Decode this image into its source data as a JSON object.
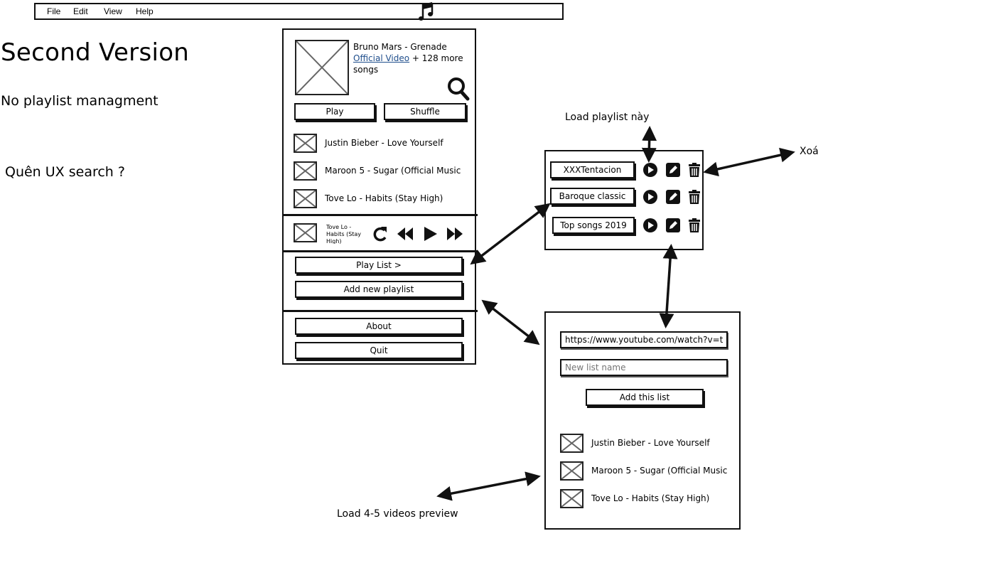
{
  "menubar": {
    "items": [
      "File",
      "Edit",
      "View",
      "Help"
    ],
    "app_icon": "music-note-icon"
  },
  "notes": {
    "title": "Second Version",
    "note1": "No playlist managment",
    "note2": "Quên UX search ?"
  },
  "player": {
    "now_playing": {
      "title": "Bruno Mars - Grenade",
      "link_text": "Official Video",
      "more_text": " + 128 more songs"
    },
    "buttons": {
      "play": "Play",
      "shuffle": "Shuffle"
    },
    "queue": [
      "Justin Bieber - Love Yourself",
      "Maroon 5 - Sugar (Official Music",
      "Tove Lo - Habits (Stay High)"
    ],
    "mini_player": {
      "title": "Tove Lo - Habits (Stay High)",
      "controls": [
        "repeat-icon",
        "rewind-icon",
        "play-icon",
        "fast-forward-icon"
      ]
    },
    "menu": {
      "playlist": "Play List >",
      "add_playlist": "Add new playlist",
      "about": "About",
      "quit": "Quit"
    }
  },
  "playlists": {
    "items": [
      {
        "name": "XXXTentacion"
      },
      {
        "name": "Baroque classic"
      },
      {
        "name": "Top songs 2019"
      }
    ],
    "actions": [
      "play-icon",
      "edit-icon",
      "trash-icon"
    ]
  },
  "add_list": {
    "url_value": "https://www.youtube.com/watch?v=tri",
    "name_placeholder": "New list name",
    "add_button": "Add this list",
    "preview": [
      "Justin Bieber - Love Yourself",
      "Maroon 5 - Sugar (Official Music",
      "Tove Lo - Habits (Stay High)"
    ]
  },
  "annotations": {
    "load_playlist": "Load playlist này",
    "delete": "Xoá",
    "load_preview": "Load 4-5 videos preview"
  },
  "colors": {
    "ink": "#111111",
    "placeholder_x": "#666666",
    "link": "#1f4e8c"
  }
}
